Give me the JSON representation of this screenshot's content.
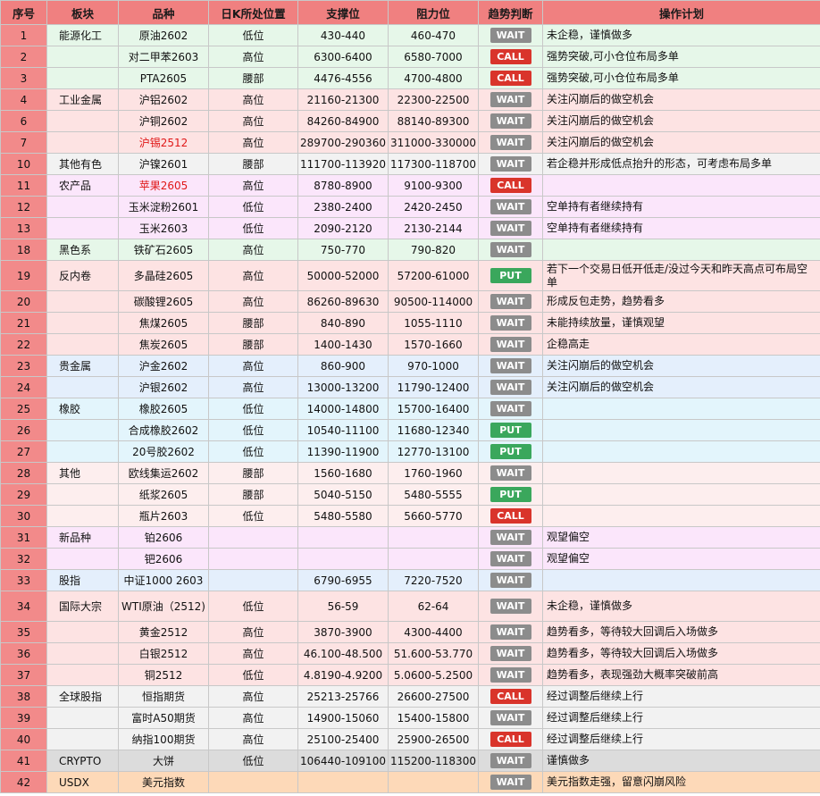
{
  "headers": [
    "序号",
    "板块",
    "品种",
    "日K所处位置",
    "支撑位",
    "阻力位",
    "趋势判断",
    "操作计划"
  ],
  "rows": [
    {
      "idx": "1",
      "sector": "能源化工",
      "product": "原油2602",
      "position": "低位",
      "support": "430-440",
      "resistance": "460-470",
      "signal": "WAIT",
      "plan": "未企稳，谨慎做多",
      "bg": "#e6f7e9"
    },
    {
      "idx": "2",
      "sector": "",
      "product": "对二甲苯2603",
      "position": "高位",
      "support": "6300-6400",
      "resistance": "6580-7000",
      "signal": "CALL",
      "plan": "强势突破,可小仓位布局多单",
      "bg": "#e6f7e9"
    },
    {
      "idx": "3",
      "sector": "",
      "product": "PTA2605",
      "position": "腰部",
      "support": "4476-4556",
      "resistance": "4700-4800",
      "signal": "CALL",
      "plan": "强势突破,可小仓位布局多单",
      "bg": "#e6f7e9"
    },
    {
      "idx": "4",
      "sector": "工业金属",
      "product": "沪铝2602",
      "position": "高位",
      "support": "21160-21300",
      "resistance": "22300-22500",
      "signal": "WAIT",
      "plan": "关注闪崩后的做空机会",
      "bg": "#fde3e3"
    },
    {
      "idx": "6",
      "sector": "",
      "product": "沪铜2602",
      "position": "高位",
      "support": "84260-84900",
      "resistance": "88140-89300",
      "signal": "WAIT",
      "plan": "关注闪崩后的做空机会",
      "bg": "#fde3e3"
    },
    {
      "idx": "7",
      "sector": "",
      "product": "沪锡2512",
      "position": "高位",
      "support": "289700-290360",
      "resistance": "311000-330000",
      "signal": "WAIT",
      "plan": "关注闪崩后的做空机会",
      "bg": "#fde3e3",
      "red": true
    },
    {
      "idx": "10",
      "sector": "其他有色",
      "product": "沪镍2601",
      "position": "腰部",
      "support": "111700-113920",
      "resistance": "117300-118700",
      "signal": "WAIT",
      "plan": "若企稳并形成低点抬升的形态，可考虑布局多单",
      "bg": "#f2f2f2"
    },
    {
      "idx": "11",
      "sector": "农产品",
      "product": "苹果2605",
      "position": "高位",
      "support": "8780-8900",
      "resistance": "9100-9300",
      "signal": "CALL",
      "plan": "",
      "bg": "#fbe6fb",
      "red": true
    },
    {
      "idx": "12",
      "sector": "",
      "product": "玉米淀粉2601",
      "position": "低位",
      "support": "2380-2400",
      "resistance": "2420-2450",
      "signal": "WAIT",
      "plan": "空单持有者继续持有",
      "bg": "#fbe6fb"
    },
    {
      "idx": "13",
      "sector": "",
      "product": "玉米2603",
      "position": "低位",
      "support": "2090-2120",
      "resistance": "2130-2144",
      "signal": "WAIT",
      "plan": "空单持有者继续持有",
      "bg": "#fbe6fb"
    },
    {
      "idx": "18",
      "sector": "黑色系",
      "product": "铁矿石2605",
      "position": "高位",
      "support": "750-770",
      "resistance": "790-820",
      "signal": "WAIT",
      "plan": "",
      "bg": "#e6f7e9"
    },
    {
      "idx": "19",
      "sector": "反内卷",
      "product": "多晶硅2605",
      "position": "高位",
      "support": "50000-52000",
      "resistance": "57200-61000",
      "signal": "PUT",
      "plan": "若下一个交易日低开低走/没过今天和昨天高点可布局空单",
      "bg": "#fde3e3",
      "tall": true
    },
    {
      "idx": "20",
      "sector": "",
      "product": "碳酸锂2605",
      "position": "高位",
      "support": "86260-89630",
      "resistance": "90500-114000",
      "signal": "WAIT",
      "plan": "形成反包走势，趋势看多",
      "bg": "#fde3e3"
    },
    {
      "idx": "21",
      "sector": "",
      "product": "焦煤2605",
      "position": "腰部",
      "support": "840-890",
      "resistance": "1055-1110",
      "signal": "WAIT",
      "plan": "未能持续放量，谨慎观望",
      "bg": "#fde3e3"
    },
    {
      "idx": "22",
      "sector": "",
      "product": "焦炭2605",
      "position": "腰部",
      "support": "1400-1430",
      "resistance": "1570-1660",
      "signal": "WAIT",
      "plan": "企稳高走",
      "bg": "#fde3e3"
    },
    {
      "idx": "23",
      "sector": "贵金属",
      "product": "沪金2602",
      "position": "高位",
      "support": "860-900",
      "resistance": "970-1000",
      "signal": "WAIT",
      "plan": "关注闪崩后的做空机会",
      "bg": "#e4effc"
    },
    {
      "idx": "24",
      "sector": "",
      "product": "沪银2602",
      "position": "高位",
      "support": "13000-13200",
      "resistance": "11790-12400",
      "signal": "WAIT",
      "plan": "关注闪崩后的做空机会",
      "bg": "#e4effc"
    },
    {
      "idx": "25",
      "sector": "橡胶",
      "product": "橡胶2605",
      "position": "低位",
      "support": "14000-14800",
      "resistance": "15700-16400",
      "signal": "WAIT",
      "plan": "",
      "bg": "#e3f5fc"
    },
    {
      "idx": "26",
      "sector": "",
      "product": "合成橡胶2602",
      "position": "低位",
      "support": "10540-11100",
      "resistance": "11680-12340",
      "signal": "PUT",
      "plan": "",
      "bg": "#e3f5fc"
    },
    {
      "idx": "27",
      "sector": "",
      "product": "20号胶2602",
      "position": "低位",
      "support": "11390-11900",
      "resistance": "12770-13100",
      "signal": "PUT",
      "plan": "",
      "bg": "#e3f5fc"
    },
    {
      "idx": "28",
      "sector": "其他",
      "product": "欧线集运2602",
      "position": "腰部",
      "support": "1560-1680",
      "resistance": "1760-1960",
      "signal": "WAIT",
      "plan": "",
      "bg": "#fdeeee"
    },
    {
      "idx": "29",
      "sector": "",
      "product": "纸浆2605",
      "position": "腰部",
      "support": "5040-5150",
      "resistance": "5480-5555",
      "signal": "PUT",
      "plan": "",
      "bg": "#fdeeee"
    },
    {
      "idx": "30",
      "sector": "",
      "product": "瓶片2603",
      "position": "低位",
      "support": "5480-5580",
      "resistance": "5660-5770",
      "signal": "CALL",
      "plan": "",
      "bg": "#fdeeee"
    },
    {
      "idx": "31",
      "sector": "新品种",
      "product": "铂2606",
      "position": "",
      "support": "",
      "resistance": "",
      "signal": "WAIT",
      "plan": "观望偏空",
      "bg": "#fbe6fb"
    },
    {
      "idx": "32",
      "sector": "",
      "product": "钯2606",
      "position": "",
      "support": "",
      "resistance": "",
      "signal": "WAIT",
      "plan": "观望偏空",
      "bg": "#fbe6fb"
    },
    {
      "idx": "33",
      "sector": "股指",
      "product": "中证1000 2603",
      "position": "",
      "support": "6790-6955",
      "resistance": "7220-7520",
      "signal": "WAIT",
      "plan": "",
      "bg": "#e4effc"
    },
    {
      "idx": "34",
      "sector": "国际大宗",
      "product": "WTI原油（2512)",
      "position": "低位",
      "support": "56-59",
      "resistance": "62-64",
      "signal": "WAIT",
      "plan": "未企稳，谨慎做多",
      "bg": "#fde3e3",
      "tall": true
    },
    {
      "idx": "35",
      "sector": "",
      "product": "黄金2512",
      "position": "高位",
      "support": "3870-3900",
      "resistance": "4300-4400",
      "signal": "WAIT",
      "plan": "趋势看多，等待较大回调后入场做多",
      "bg": "#fde3e3"
    },
    {
      "idx": "36",
      "sector": "",
      "product": "白银2512",
      "position": "高位",
      "support": "46.100-48.500",
      "resistance": "51.600-53.770",
      "signal": "WAIT",
      "plan": "趋势看多，等待较大回调后入场做多",
      "bg": "#fde3e3"
    },
    {
      "idx": "37",
      "sector": "",
      "product": "铜2512",
      "position": "低位",
      "support": "4.8190-4.9200",
      "resistance": "5.0600-5.2500",
      "signal": "WAIT",
      "plan": "趋势看多，表现强劲大概率突破前高",
      "bg": "#fde3e3"
    },
    {
      "idx": "38",
      "sector": "全球股指",
      "product": "恒指期货",
      "position": "高位",
      "support": "25213-25766",
      "resistance": "26600-27500",
      "signal": "CALL",
      "plan": "经过调整后继续上行",
      "bg": "#f2f2f2"
    },
    {
      "idx": "39",
      "sector": "",
      "product": "富时A50期货",
      "position": "高位",
      "support": "14900-15060",
      "resistance": "15400-15800",
      "signal": "WAIT",
      "plan": "经过调整后继续上行",
      "bg": "#f2f2f2"
    },
    {
      "idx": "40",
      "sector": "",
      "product": "纳指100期货",
      "position": "高位",
      "support": "25100-25400",
      "resistance": "25900-26500",
      "signal": "CALL",
      "plan": "经过调整后继续上行",
      "bg": "#f2f2f2"
    },
    {
      "idx": "41",
      "sector": "CRYPTO",
      "product": "大饼",
      "position": "低位",
      "support": "106440-109100",
      "resistance": "115200-118300",
      "signal": "WAIT",
      "plan": "谨慎做多",
      "bg": "#dcdcdc"
    },
    {
      "idx": "42",
      "sector": "USDX",
      "product": "美元指数",
      "position": "",
      "support": "",
      "resistance": "",
      "signal": "WAIT",
      "plan": "美元指数走强，留意闪崩风险",
      "bg": "#fdd9b8"
    }
  ]
}
